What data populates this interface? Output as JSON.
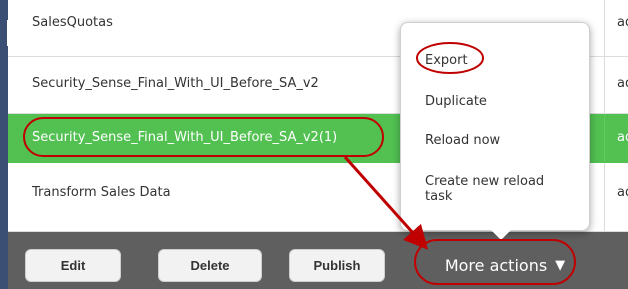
{
  "rows": [
    {
      "name": "SalesQuotas",
      "col2": "ad"
    },
    {
      "name": "Security_Sense_Final_With_UI_Before_SA_v2",
      "col2": "ad"
    },
    {
      "name": "Security_Sense_Final_With_UI_Before_SA_v2(1)",
      "col2": "ad"
    },
    {
      "name": "Transform Sales Data",
      "col2": "ad"
    }
  ],
  "toolbar": {
    "edit_label": "Edit",
    "delete_label": "Delete",
    "publish_label": "Publish",
    "more_actions_label": "More actions",
    "caret_icon": "caret-down-icon"
  },
  "more_actions_menu": {
    "items": [
      "Export",
      "Duplicate",
      "Reload now",
      "Create new reload task"
    ]
  },
  "colors": {
    "selected_row": "#52c152",
    "toolbar": "#5f5f5f",
    "annotation": "#c00000",
    "sidebar_edge": "#3b4f75"
  }
}
